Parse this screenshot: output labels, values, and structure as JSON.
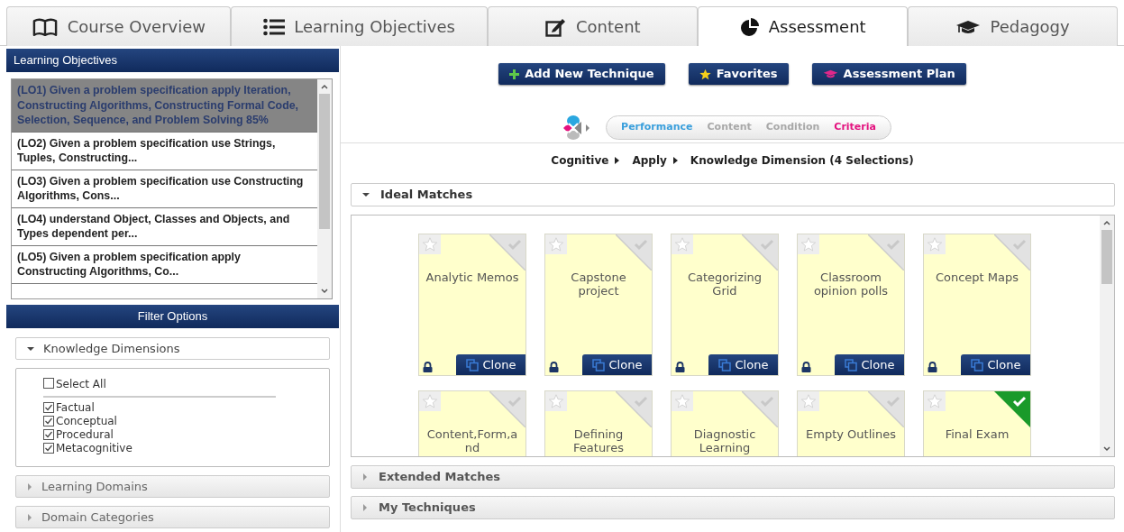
{
  "tabs": [
    {
      "label": "Course Overview",
      "selected": false
    },
    {
      "label": "Learning Objectives",
      "selected": false
    },
    {
      "label": "Content",
      "selected": false
    },
    {
      "label": "Assessment",
      "selected": true
    },
    {
      "label": "Pedagogy",
      "selected": false
    }
  ],
  "objectives_panel": {
    "title": "Learning Objectives",
    "items": [
      {
        "text": "(LO1) Given a problem specification apply Iteration, Constructing Algorithms, Constructing Formal Code, Selection, Sequence, and Problem Solving 85%",
        "selected": true
      },
      {
        "text": "(LO2) Given a problem specification use Strings, Tuples, Constructing...",
        "selected": false
      },
      {
        "text": "(LO3) Given a problem specification use Constructing Algorithms, Cons...",
        "selected": false
      },
      {
        "text": "(LO4) understand Object, Classes and Objects, and Types dependent per...",
        "selected": false
      },
      {
        "text": "(LO5) Given a problem specification apply Constructing Algorithms, Co...",
        "selected": false
      }
    ]
  },
  "filter_panel": {
    "title": "Filter Options",
    "sections": [
      {
        "label": "Knowledge Dimensions",
        "expanded": true,
        "select_all": {
          "label": "Select All",
          "checked": false
        },
        "options": [
          {
            "label": "Factual",
            "checked": true
          },
          {
            "label": "Conceptual",
            "checked": true
          },
          {
            "label": "Procedural",
            "checked": true
          },
          {
            "label": "Metacognitive",
            "checked": true
          }
        ]
      },
      {
        "label": "Learning Domains",
        "expanded": false
      },
      {
        "label": "Domain Categories",
        "expanded": false
      }
    ]
  },
  "toolbar": {
    "buttons": [
      "Add New Technique",
      "Favorites",
      "Assessment Plan"
    ]
  },
  "criteria": {
    "steps": [
      {
        "label": "Performance",
        "color": "#3a9fdc"
      },
      {
        "label": "Content",
        "color": "#a8a8a8"
      },
      {
        "label": "Condition",
        "color": "#a8a8a8"
      },
      {
        "label": "Criteria",
        "color": "#e4127f"
      }
    ]
  },
  "breadcrumb": [
    "Cognitive",
    "Apply",
    "Knowledge Dimension (4 Selections)"
  ],
  "match_sections": [
    {
      "label": "Ideal Matches",
      "expanded": true,
      "techniques": [
        {
          "name": "Analytic Memos",
          "selected": false,
          "locked": true,
          "action": "Clone"
        },
        {
          "name": "Capstone project",
          "selected": false,
          "locked": true,
          "action": "Clone"
        },
        {
          "name": "Categorizing Grid",
          "selected": false,
          "locked": true,
          "action": "Clone"
        },
        {
          "name": "Classroom opinion polls",
          "selected": false,
          "locked": true,
          "action": "Clone"
        },
        {
          "name": "Concept Maps",
          "selected": false,
          "locked": true,
          "action": "Clone"
        },
        {
          "name": "Content,Form,and",
          "selected": false
        },
        {
          "name": "Defining Features",
          "selected": false
        },
        {
          "name": "Diagnostic Learning",
          "selected": false
        },
        {
          "name": "Empty Outlines",
          "selected": false
        },
        {
          "name": "Final Exam",
          "selected": true
        }
      ]
    },
    {
      "label": "Extended Matches",
      "expanded": false
    },
    {
      "label": "My Techniques",
      "expanded": false
    }
  ]
}
